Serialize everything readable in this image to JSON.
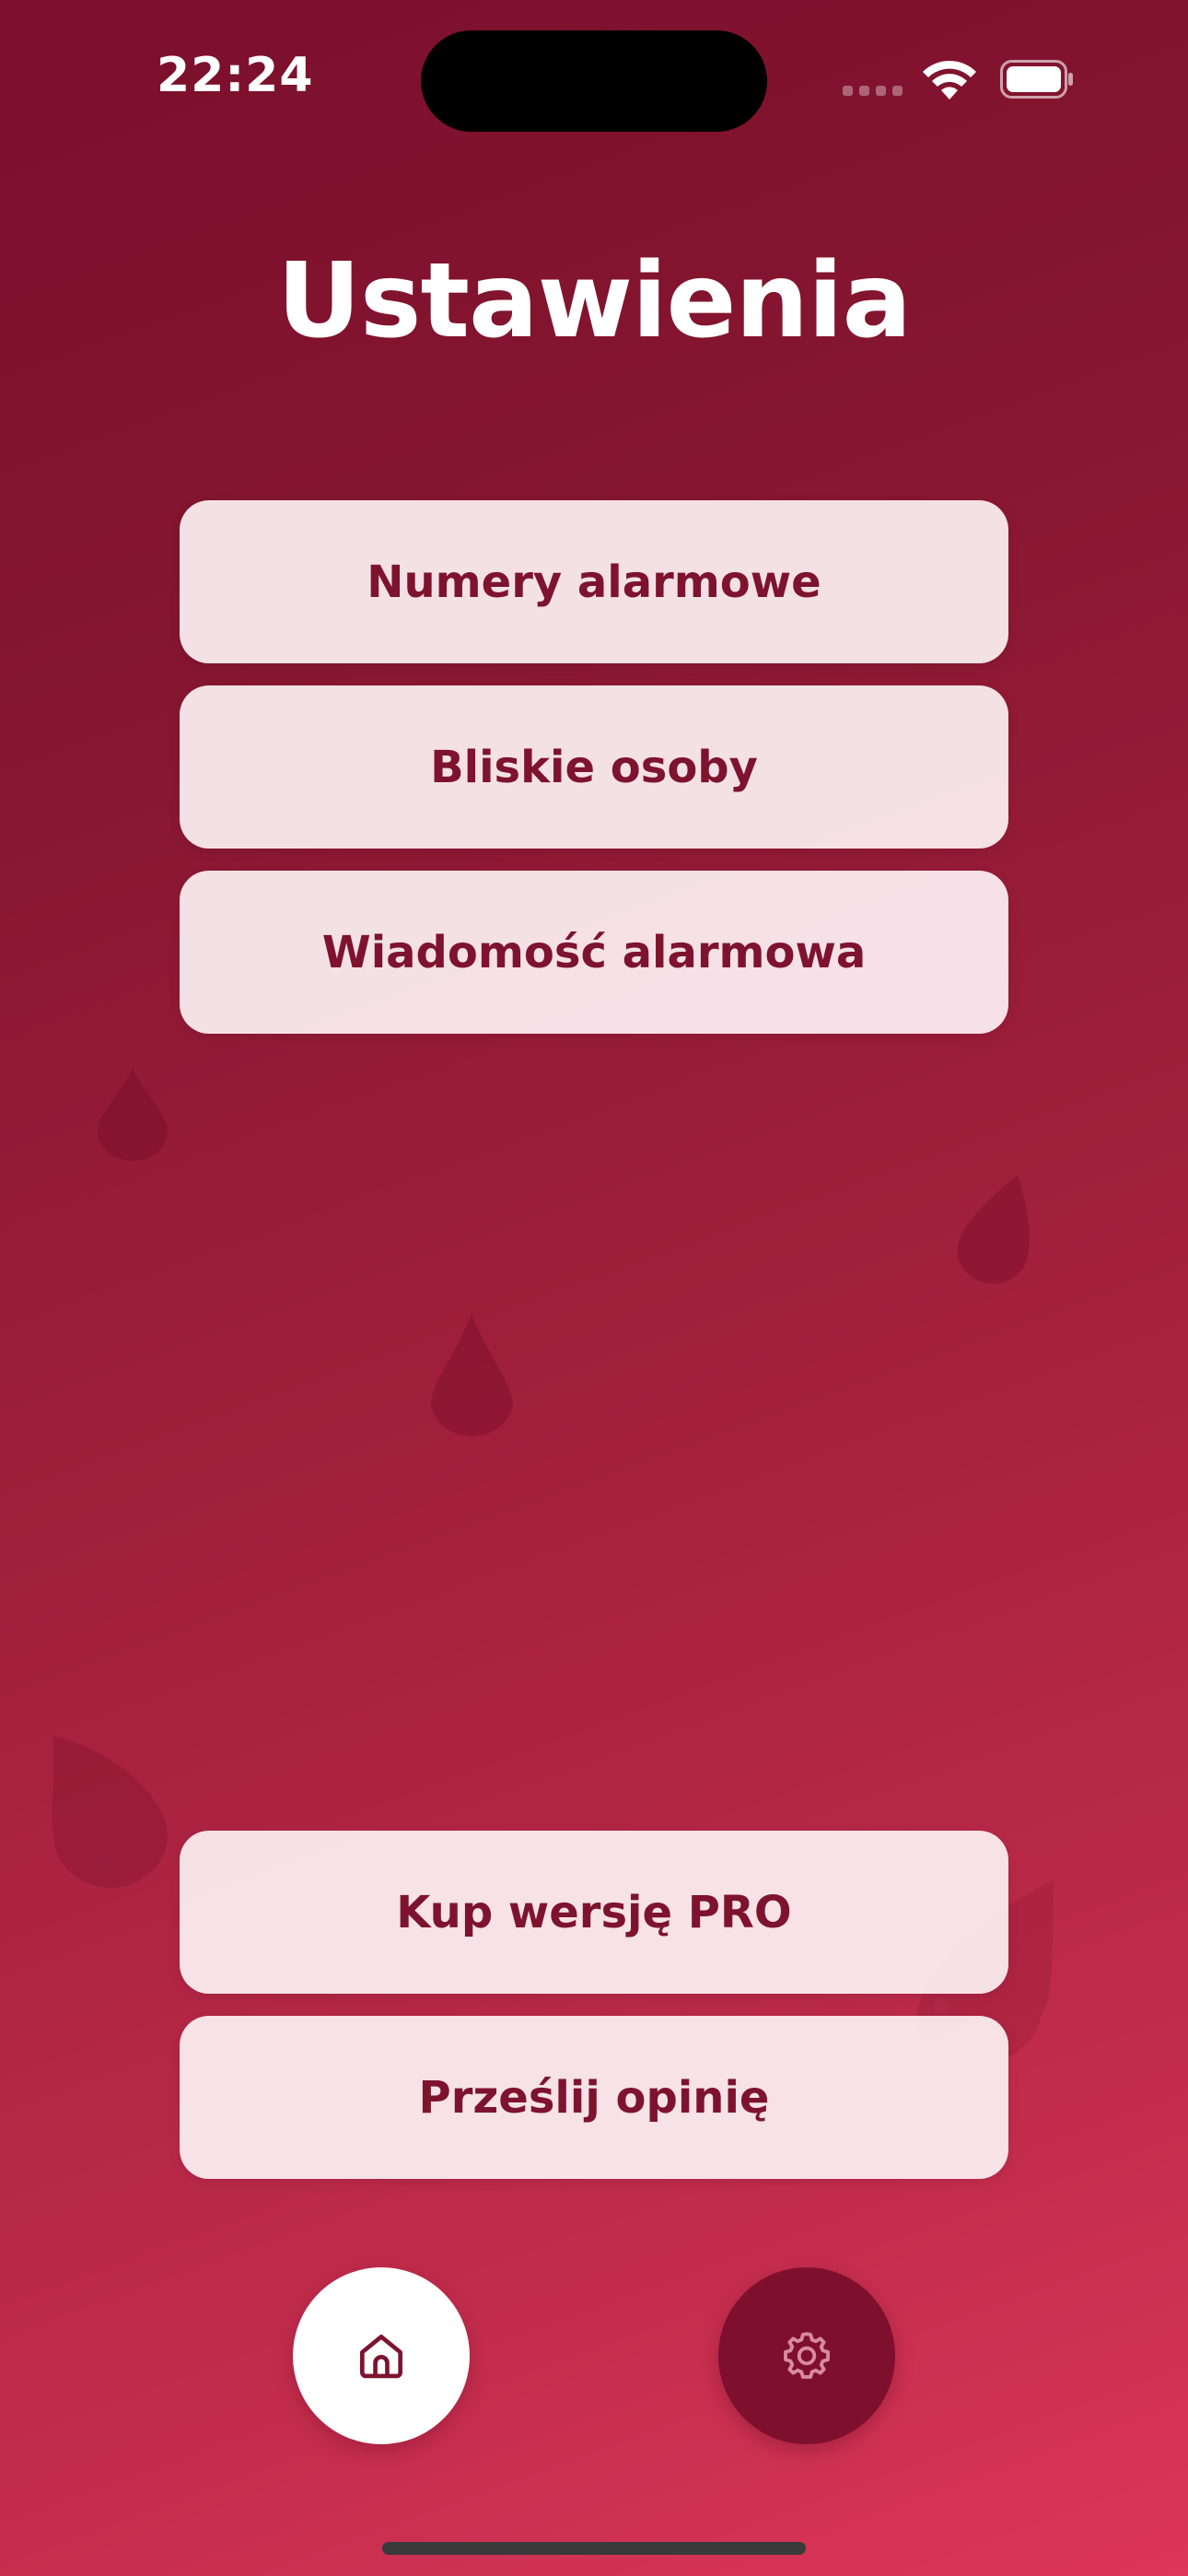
{
  "status_bar": {
    "time": "22:24"
  },
  "header": {
    "title": "Ustawienia"
  },
  "menu": {
    "items": [
      {
        "label": "Numery alarmowe"
      },
      {
        "label": "Bliskie osoby"
      },
      {
        "label": "Wiadomość alarmowa"
      }
    ]
  },
  "footer_actions": {
    "items": [
      {
        "label": "Kup wersję PRO"
      },
      {
        "label": "Prześlij opinię"
      }
    ]
  },
  "bottom_nav": {
    "items": [
      {
        "icon": "home-icon",
        "active": false
      },
      {
        "icon": "gear-icon",
        "active": true
      }
    ]
  },
  "colors": {
    "background_top": "#7b0f2c",
    "background_bottom": "#dc3659",
    "button_background": "#f7e9ed",
    "button_text": "#7e132f",
    "active_nav": "#7e102d"
  }
}
